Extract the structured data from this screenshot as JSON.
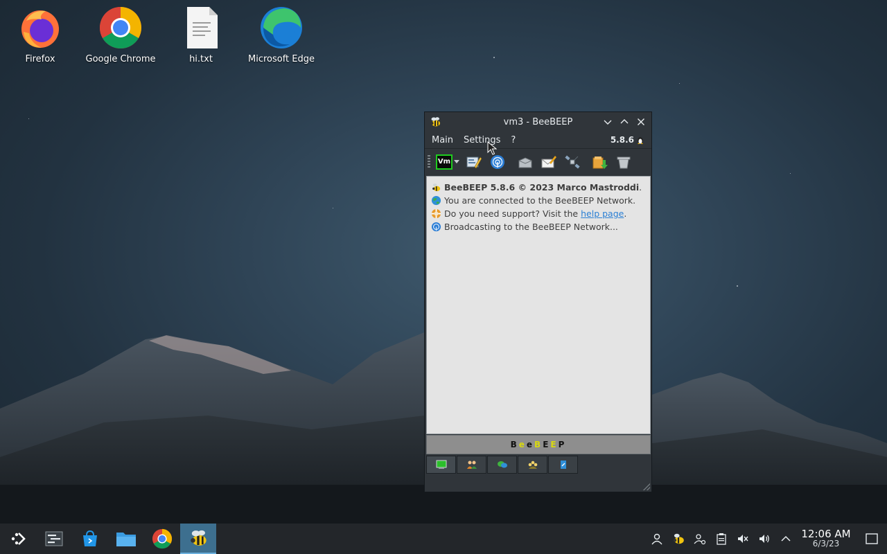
{
  "desktop": {
    "icons": [
      {
        "label": "Firefox",
        "icon": "firefox-icon"
      },
      {
        "label": "Google Chrome",
        "icon": "chrome-icon"
      },
      {
        "label": "hi.txt",
        "icon": "text-file-icon"
      },
      {
        "label": "Microsoft Edge",
        "icon": "edge-icon"
      }
    ]
  },
  "window": {
    "title": "vm3 - BeeBEEP",
    "menu": {
      "main": "Main",
      "settings": "Settings",
      "help": "?",
      "version": "5.8.6"
    },
    "toolbar": {
      "vm_label": "Vm"
    },
    "chat": {
      "line1_bold": "BeeBEEP 5.8.6 © 2023 Marco Mastroddi",
      "line1_end": ".",
      "line2": "You are connected to the BeeBEEP Network.",
      "line3_start": "Do you need support? Visit the ",
      "line3_link": "help page",
      "line3_end": ".",
      "line4": "Broadcasting to the BeeBEEP Network..."
    },
    "footer": {
      "letters": [
        "B",
        "e",
        "e",
        "B",
        "E",
        "E",
        "P"
      ],
      "colors": [
        "#111111",
        "#d8d810",
        "#111111",
        "#d8d810",
        "#111111",
        "#d8d810",
        "#111111"
      ]
    }
  },
  "taskbar": {
    "clock_time": "12:06 AM",
    "clock_date": "6/3/23"
  },
  "colors": {
    "accent": "#3d6f8f",
    "link": "#2a7fd4",
    "status_green": "#1fcc1f"
  }
}
